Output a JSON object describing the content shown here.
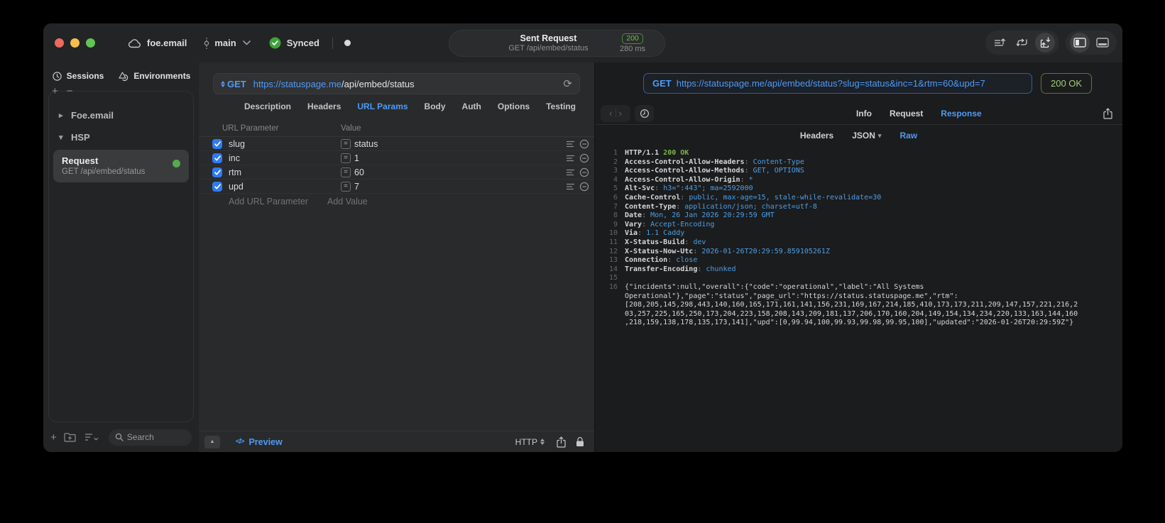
{
  "titlebar": {
    "project": "foe.email",
    "branch": "main",
    "sync_label": "Synced",
    "request_title": "Sent Request",
    "request_subtitle": "GET /api/embed/status",
    "status_code": "200",
    "duration": "280 ms"
  },
  "sidebar": {
    "tabs": [
      {
        "label": "Sessions"
      },
      {
        "label": "Environments"
      }
    ],
    "tree": [
      {
        "label": "Foe.email"
      },
      {
        "label": "HSP"
      }
    ],
    "request_item": {
      "title": "Request",
      "subtitle": "GET /api/embed/status"
    },
    "search_placeholder": "Search"
  },
  "request_panel": {
    "method": "GET",
    "url_host": "https://statuspage.me",
    "url_path": "/api/embed/status",
    "tabs": [
      "Description",
      "Headers",
      "URL Params",
      "Body",
      "Auth",
      "Options",
      "Testing"
    ],
    "table": {
      "col_param": "URL Parameter",
      "col_value": "Value",
      "rows": [
        {
          "name": "slug",
          "value": "status"
        },
        {
          "name": "inc",
          "value": "1"
        },
        {
          "name": "rtm",
          "value": "60"
        },
        {
          "name": "upd",
          "value": "7"
        }
      ],
      "add_param": "Add URL Parameter",
      "add_value": "Add Value"
    },
    "footer": {
      "preview": "Preview",
      "code_glyph": "</>",
      "protocol": "HTTP"
    }
  },
  "response_panel": {
    "method": "GET",
    "url": "https://statuspage.me/api/embed/status?slug=status&inc=1&rtm=60&upd=7",
    "status": "200 OK",
    "tabs": [
      "Info",
      "Request",
      "Response"
    ],
    "subtabs": [
      "Headers",
      "JSON",
      "Raw"
    ],
    "colon": ":",
    "status_line": {
      "num": "1",
      "protocol": "HTTP/1.1",
      "status": "200 OK"
    },
    "headers": [
      {
        "num": "2",
        "name": "Access-Control-Allow-Headers",
        "value": "Content-Type"
      },
      {
        "num": "3",
        "name": "Access-Control-Allow-Methods",
        "value": "GET, OPTIONS"
      },
      {
        "num": "4",
        "name": "Access-Control-Allow-Origin",
        "value": "*"
      },
      {
        "num": "5",
        "name": "Alt-Svc",
        "value": "h3=\":443\"; ma=2592000"
      },
      {
        "num": "6",
        "name": "Cache-Control",
        "value": "public, max-age=15, stale-while-revalidate=30"
      },
      {
        "num": "7",
        "name": "Content-Type",
        "value": "application/json; charset=utf-8"
      },
      {
        "num": "8",
        "name": "Date",
        "value": "Mon, 26 Jan 2026 20:29:59 GMT"
      },
      {
        "num": "9",
        "name": "Vary",
        "value": "Accept-Encoding"
      },
      {
        "num": "10",
        "name": "Via",
        "value": "1.1 Caddy"
      },
      {
        "num": "11",
        "name": "X-Status-Build",
        "value": "dev"
      },
      {
        "num": "12",
        "name": "X-Status-Now-Utc",
        "value": "2026-01-26T20:29:59.859105261Z"
      },
      {
        "num": "13",
        "name": "Connection",
        "value": "close"
      },
      {
        "num": "14",
        "name": "Transfer-Encoding",
        "value": "chunked"
      }
    ],
    "blank_line_num": "15",
    "body_line_num": "16",
    "body": "{\"incidents\":null,\"overall\":{\"code\":\"operational\",\"label\":\"All Systems Operational\"},\"page\":\"status\",\"page_url\":\"https://status.statuspage.me\",\"rtm\":[208,205,145,298,443,140,160,165,171,161,141,156,231,169,167,214,185,410,173,173,211,209,147,157,221,216,203,257,225,165,250,173,204,223,158,208,143,209,181,137,206,170,160,204,149,154,134,234,220,133,163,144,160,218,159,138,178,135,173,141],\"upd\":[0,99.94,100,99.93,99.98,99.95,100],\"updated\":\"2026-01-26T20:29:59Z\"}"
  },
  "colors": {
    "accent_blue": "#4e9bf5",
    "success_green": "#74b950",
    "checkbox_blue": "#2e7bf3"
  }
}
